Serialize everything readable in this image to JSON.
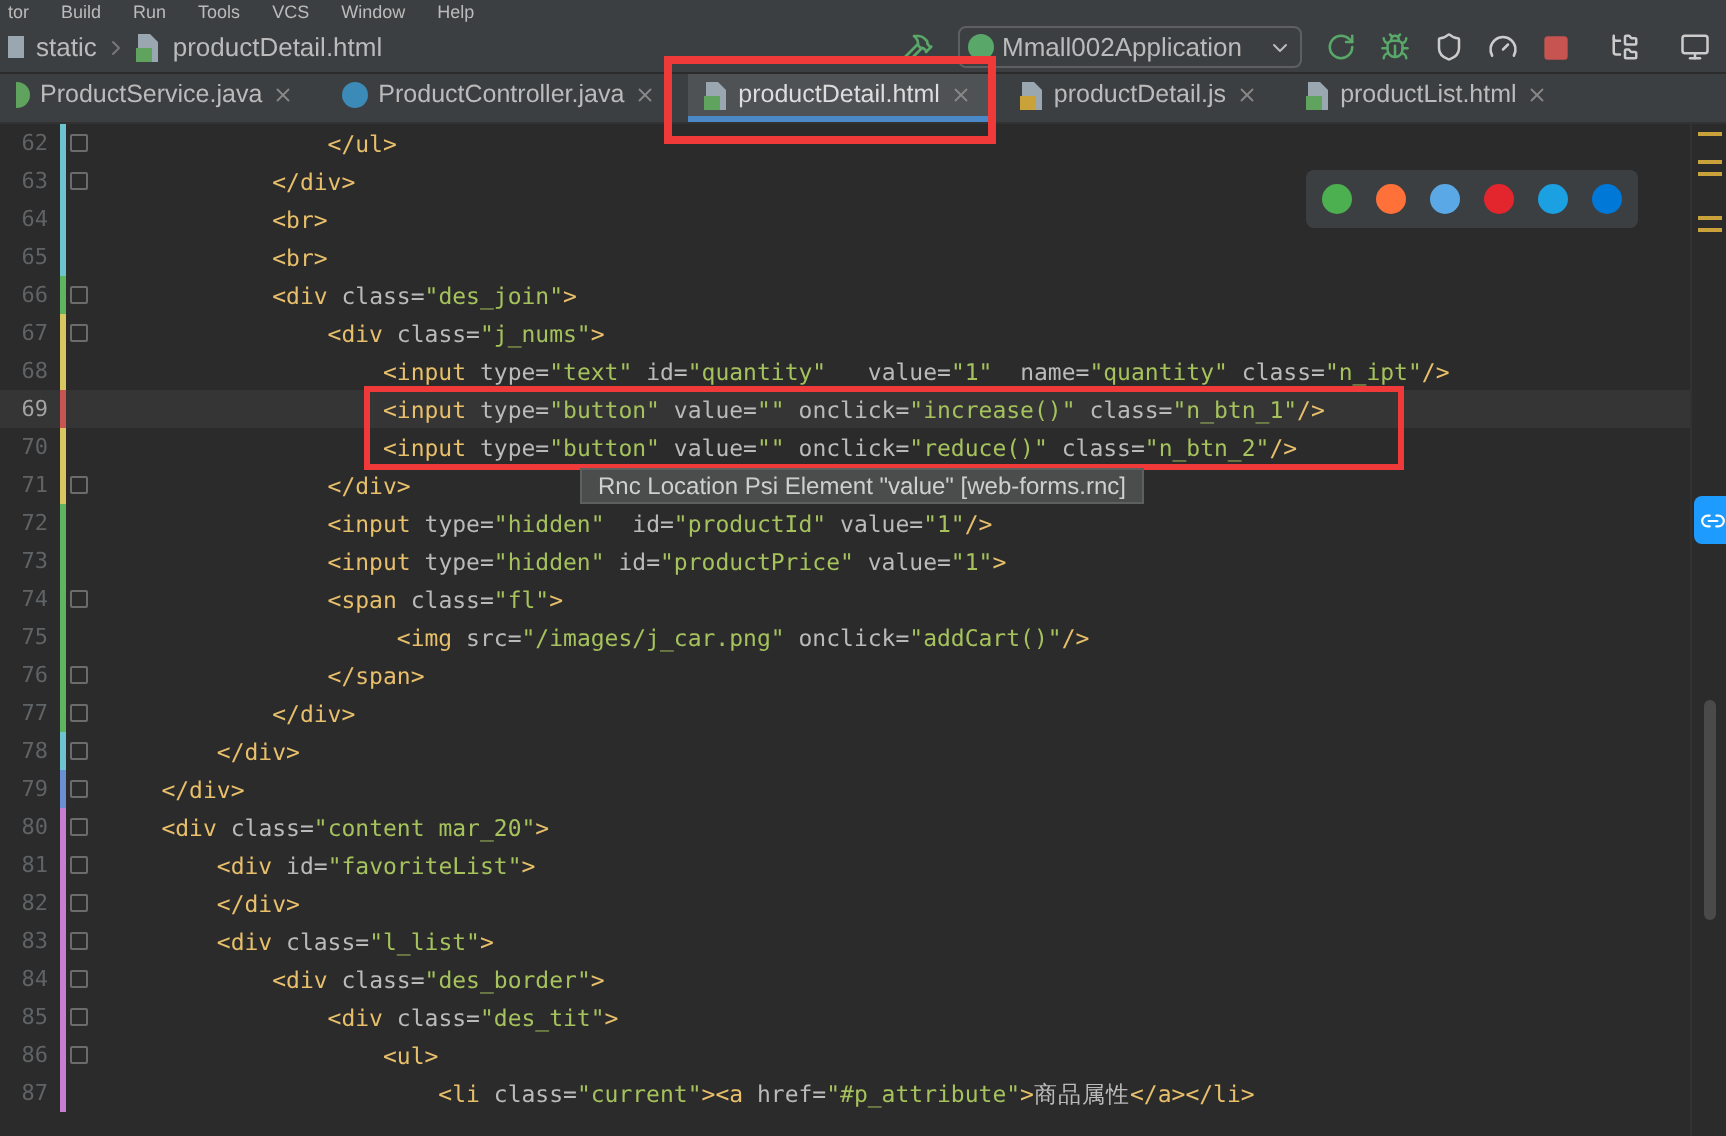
{
  "menu_bar": [
    "tor",
    "Build",
    "Run",
    "Tools",
    "VCS",
    "Window",
    "Help"
  ],
  "breadcrumb": [
    {
      "kind": "folder",
      "label": "static"
    },
    {
      "kind": "html",
      "label": "productDetail.html"
    }
  ],
  "run_config": {
    "label": "Mmall002Application"
  },
  "tabs": [
    {
      "label": "ProductService.java",
      "kind": "java",
      "selected": false
    },
    {
      "label": "ProductController.java",
      "kind": "class",
      "selected": false
    },
    {
      "label": "productDetail.html",
      "kind": "html",
      "selected": true
    },
    {
      "label": "productDetail.js",
      "kind": "js",
      "selected": false
    },
    {
      "label": "productList.html",
      "kind": "html",
      "selected": false
    }
  ],
  "editor": {
    "lines": [
      {
        "number": "62",
        "color": "#6bc4d0",
        "fold": true,
        "current": false,
        "code": "                </ul>"
      },
      {
        "number": "63",
        "color": "#6bc4d0",
        "fold": true,
        "current": false,
        "code": "            </div>"
      },
      {
        "number": "64",
        "color": "#6bc4d0",
        "fold": false,
        "current": false,
        "code": "            <br>"
      },
      {
        "number": "65",
        "color": "#6bc4d0",
        "fold": false,
        "current": false,
        "code": "            <br>"
      },
      {
        "number": "66",
        "color": "#5fb55f",
        "fold": true,
        "current": false,
        "code": "            <div class=\"des_join\">"
      },
      {
        "number": "67",
        "color": "#d8c760",
        "fold": true,
        "current": false,
        "code": "                <div class=\"j_nums\">"
      },
      {
        "number": "68",
        "color": "#d8c760",
        "fold": false,
        "current": false,
        "code": "                    <input type=\"text\" id=\"quantity\"   value=\"1\"  name=\"quantity\" class=\"n_ipt\"/>"
      },
      {
        "number": "69",
        "color": "#c75450",
        "fold": false,
        "current": true,
        "code": "                    <input type=\"button\" value=\"\" onclick=\"increase()\" class=\"n_btn_1\"/>"
      },
      {
        "number": "70",
        "color": "#d8c760",
        "fold": false,
        "current": false,
        "code": "                    <input type=\"button\" value=\"\" onclick=\"reduce()\" class=\"n_btn_2\"/>"
      },
      {
        "number": "71",
        "color": "#d8c760",
        "fold": true,
        "current": false,
        "code": "                </div>"
      },
      {
        "number": "72",
        "color": "#5fb55f",
        "fold": false,
        "current": false,
        "code": "                <input type=\"hidden\"  id=\"productId\" value=\"1\"/>"
      },
      {
        "number": "73",
        "color": "#5fb55f",
        "fold": false,
        "current": false,
        "code": "                <input type=\"hidden\" id=\"productPrice\" value=\"1\">"
      },
      {
        "number": "74",
        "color": "#5fb55f",
        "fold": true,
        "current": false,
        "code": "                <span class=\"fl\">"
      },
      {
        "number": "75",
        "color": "#5fb55f",
        "fold": false,
        "current": false,
        "code": "                     <img src=\"/images/j_car.png\" onclick=\"addCart()\"/>"
      },
      {
        "number": "76",
        "color": "#5fb55f",
        "fold": true,
        "current": false,
        "code": "                </span>"
      },
      {
        "number": "77",
        "color": "#5fb55f",
        "fold": true,
        "current": false,
        "code": "            </div>"
      },
      {
        "number": "78",
        "color": "#6bc4d0",
        "fold": true,
        "current": false,
        "code": "        </div>"
      },
      {
        "number": "79",
        "color": "#6b8fd0",
        "fold": true,
        "current": false,
        "code": "    </div>"
      },
      {
        "number": "80",
        "color": "#c77dd0",
        "fold": true,
        "current": false,
        "code": "    <div class=\"content mar_20\">"
      },
      {
        "number": "81",
        "color": "#c77dd0",
        "fold": true,
        "current": false,
        "code": "        <div id=\"favoriteList\">"
      },
      {
        "number": "82",
        "color": "#c77dd0",
        "fold": true,
        "current": false,
        "code": "        </div>"
      },
      {
        "number": "83",
        "color": "#c77dd0",
        "fold": true,
        "current": false,
        "code": "        <div class=\"l_list\">"
      },
      {
        "number": "84",
        "color": "#c77dd0",
        "fold": true,
        "current": false,
        "code": "            <div class=\"des_border\">"
      },
      {
        "number": "85",
        "color": "#c77dd0",
        "fold": true,
        "current": false,
        "code": "                <div class=\"des_tit\">"
      },
      {
        "number": "86",
        "color": "#c77dd0",
        "fold": true,
        "current": false,
        "code": "                    <ul>"
      },
      {
        "number": "87",
        "color": "#c77dd0",
        "fold": false,
        "current": false,
        "code": "                        <li class=\"current\"><a href=\"#p_attribute\">商品属性</a></li>"
      }
    ]
  },
  "tooltip": "Rnc Location Psi Element \"value\" [web-forms.rnc]",
  "browsers": [
    {
      "color": "#4caf50"
    },
    {
      "color": "#ff7139"
    },
    {
      "color": "#5aa9e6"
    },
    {
      "color": "#e3262e"
    },
    {
      "color": "#1ba1e2"
    },
    {
      "color": "#0078d7"
    }
  ]
}
